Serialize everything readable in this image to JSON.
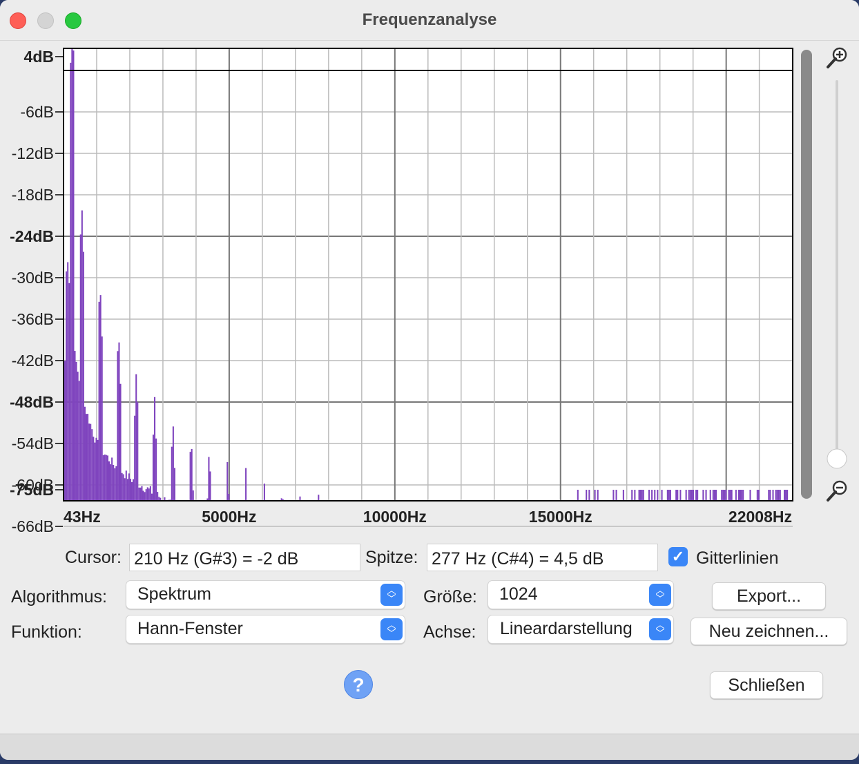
{
  "window": {
    "title": "Frequenzanalyse"
  },
  "chart_data": {
    "type": "bar",
    "xlabel": "",
    "ylabel": "",
    "xlim": [
      43,
      22008
    ],
    "ylim": [
      -75,
      4
    ],
    "y_ticks": [
      "4dB",
      "-6dB",
      "-12dB",
      "-18dB",
      "-24dB",
      "-30dB",
      "-36dB",
      "-42dB",
      "-48dB",
      "-54dB",
      "-60dB",
      "-66dB",
      "-75dB"
    ],
    "y_tick_values": [
      4,
      -6,
      -12,
      -18,
      -24,
      -30,
      -36,
      -42,
      -48,
      -54,
      -60,
      -66,
      -75
    ],
    "y_ticks_bold": [
      "4dB",
      "-24dB",
      "-48dB",
      "-75dB"
    ],
    "x_ticks": [
      "43Hz",
      "5000Hz",
      "10000Hz",
      "15000Hz",
      "22008Hz"
    ],
    "x_tick_values": [
      43,
      5000,
      10000,
      15000,
      22008
    ],
    "grid": true,
    "bar_color": "#7f44be",
    "peak_frequencies_hz": [
      277,
      550,
      1100,
      1660,
      2200,
      2750,
      3300,
      3850,
      4400,
      4950,
      5500,
      6050,
      6600,
      7150,
      7700,
      8250,
      8800,
      9350,
      9900,
      10450,
      11000,
      11550,
      12100,
      12650,
      13200,
      13750,
      14300,
      14850,
      15400,
      15950,
      16500,
      17050,
      17600,
      18150,
      18700,
      19250,
      19800,
      20350,
      20900,
      21450
    ],
    "peak_levels_db": [
      4,
      -19,
      -30,
      -37,
      -43,
      -47,
      -50,
      -52,
      -54,
      -56,
      -57,
      -58,
      -59,
      -60,
      -61,
      -62,
      -63,
      -63,
      -64,
      -64,
      -65,
      -65,
      -66,
      -66,
      -67,
      -67,
      -67,
      -68,
      -68,
      -69,
      -69,
      -69,
      -70,
      -70,
      -70,
      -70,
      -71,
      -71,
      -71,
      -71
    ],
    "floor_points_hz": [
      43,
      100,
      300,
      600,
      1000,
      1500,
      2000,
      3000,
      4000,
      5000,
      6000,
      8000,
      10000,
      12000,
      14000,
      16000,
      18000,
      20000,
      22008
    ],
    "floor_levels_db": [
      -42,
      -25,
      -40,
      -48,
      -54,
      -57,
      -59,
      -62,
      -65,
      -67,
      -69,
      -71,
      -72,
      -73,
      -74,
      -74.5,
      -75,
      -75,
      -75
    ]
  },
  "controls": {
    "cursor_label": "Cursor:",
    "cursor_value": "210 Hz (G#3) = -2 dB",
    "peak_label": "Spitze:",
    "peak_value": "277 Hz (C#4) = 4,5 dB",
    "grid_label": "Gitterlinien",
    "grid_checked": true,
    "algorithm_label": "Algorithmus:",
    "algorithm_value": "Spektrum",
    "size_label": "Größe:",
    "size_value": "1024",
    "function_label": "Funktion:",
    "function_value": "Hann-Fenster",
    "axis_label": "Achse:",
    "axis_value": "Lineardarstellung",
    "export_button": "Export...",
    "redraw_button": "Neu zeichnen...",
    "close_button": "Schließen",
    "help_button": "?"
  },
  "icons": {
    "zoom_in": "zoom-in-icon",
    "zoom_out": "zoom-out-icon",
    "checkmark": "checkmark-icon",
    "help": "help-icon"
  },
  "colors": {
    "accent": "#3a86f7",
    "bars": "#7f44be",
    "close": "#fe5f57",
    "maximize": "#28c840"
  }
}
